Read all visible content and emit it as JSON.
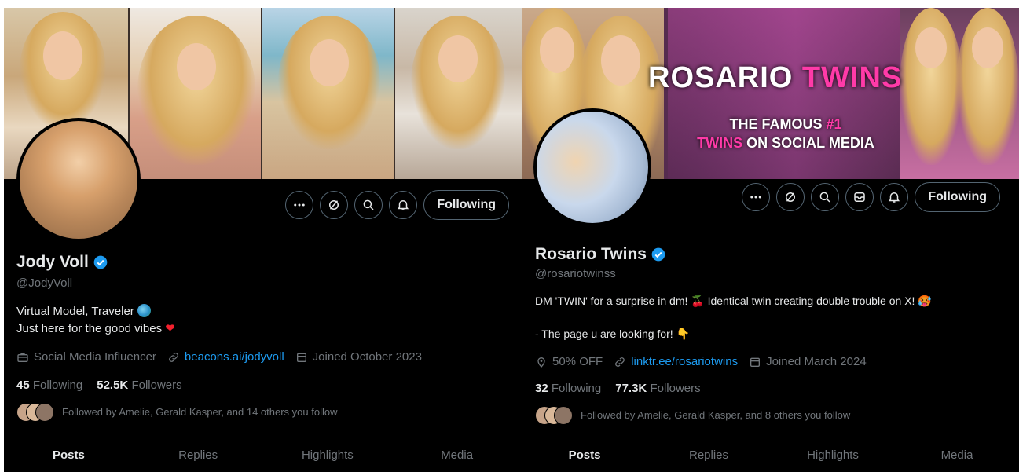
{
  "left": {
    "name": "Jody Voll",
    "handle": "@JodyVoll",
    "bio_line1": "Virtual Model, Traveler",
    "bio_line2": "Just here for the good vibes",
    "meta": {
      "category": "Social Media Influencer",
      "link": "beacons.ai/jodyvoll",
      "joined": "Joined October 2023"
    },
    "following_count": "45",
    "following_label": "Following",
    "followers_count": "52.5K",
    "followers_label": "Followers",
    "followed_by": "Followed by Amelie, Gerald Kasper, and 14 others you follow",
    "follow_button": "Following",
    "tabs": [
      "Posts",
      "Replies",
      "Highlights",
      "Media"
    ]
  },
  "right": {
    "banner_title_a": "ROSARIO ",
    "banner_title_b": "TWINS",
    "banner_sub_a": "THE FAMOUS ",
    "banner_sub_b": "#1",
    "banner_sub_c": "TWINS",
    "banner_sub_d": " ON SOCIAL MEDIA",
    "name": "Rosario Twins",
    "handle": "@rosariotwinss",
    "bio_line1": "DM 'TWIN' for a surprise in dm! 🍒 Identical twin creating double trouble on X! 🥵",
    "bio_line2": "- The page u are looking for! 👇",
    "meta": {
      "location": "50% OFF",
      "link": "linktr.ee/rosariotwins",
      "joined": "Joined March 2024"
    },
    "following_count": "32",
    "following_label": "Following",
    "followers_count": "77.3K",
    "followers_label": "Followers",
    "followed_by": "Followed by Amelie, Gerald Kasper, and 8 others you follow",
    "follow_button": "Following",
    "tabs": [
      "Posts",
      "Replies",
      "Highlights",
      "Media"
    ]
  },
  "icons": {
    "more": "more-icon",
    "grok": "grok-icon",
    "search": "search-icon",
    "message": "message-icon",
    "notify": "notification-bell-icon",
    "verified": "verified-badge-icon"
  },
  "colors": {
    "background": "#000000",
    "text": "#e7e9ea",
    "muted": "#71767b",
    "link": "#1d9bf0",
    "verified": "#1d9bf0",
    "banner_accent": "#ff3aa8",
    "heart": "#f4212e"
  }
}
